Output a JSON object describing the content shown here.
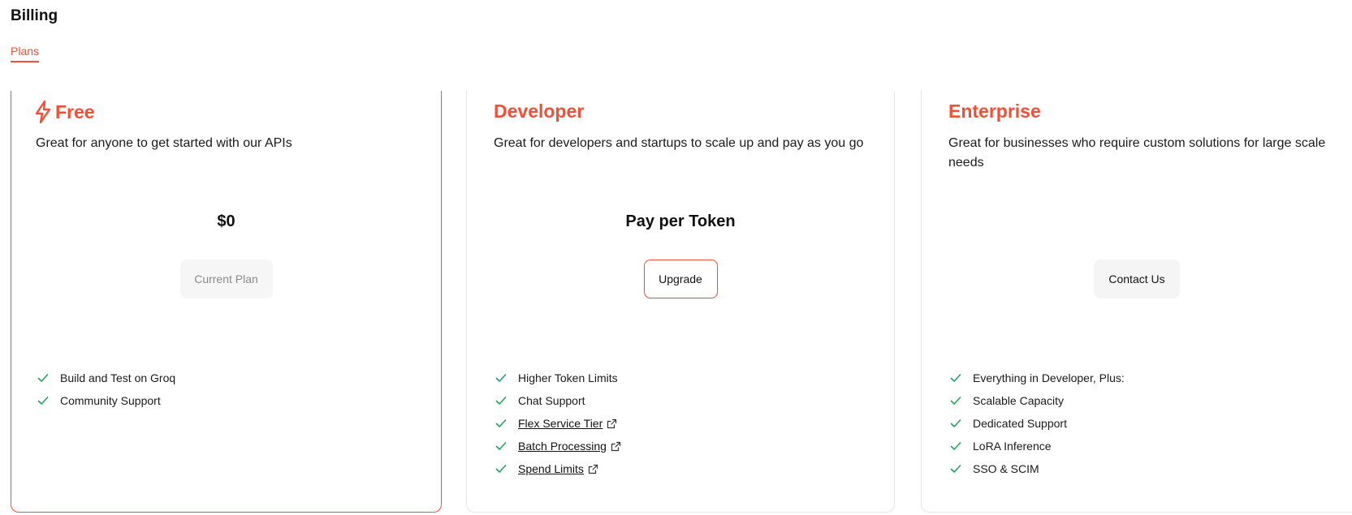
{
  "page": {
    "title": "Billing"
  },
  "tabs": [
    {
      "label": "Plans",
      "active": true
    }
  ],
  "colors": {
    "accent": "#f05033",
    "check": "#22a45d",
    "border": "#e4e4e4"
  },
  "plans": [
    {
      "name": "Free",
      "icon": "lightning-bolt-icon",
      "description": "Great for anyone to get started with our APIs",
      "price": "$0",
      "button": "Current Plan",
      "features": [
        {
          "label": "Build and Test on Groq",
          "link": false
        },
        {
          "label": "Community Support",
          "link": false
        }
      ]
    },
    {
      "name": "Developer",
      "description": "Great for developers and startups to scale up and pay as you go",
      "price": "Pay per Token",
      "button": "Upgrade",
      "features": [
        {
          "label": "Higher Token Limits",
          "link": false
        },
        {
          "label": "Chat Support",
          "link": false
        },
        {
          "label": "Flex Service Tier",
          "link": true
        },
        {
          "label": "Batch Processing",
          "link": true
        },
        {
          "label": "Spend Limits",
          "link": true
        }
      ]
    },
    {
      "name": "Enterprise",
      "description": "Great for businesses who require custom solutions for large scale needs",
      "price": "",
      "button": "Contact Us",
      "features": [
        {
          "label": "Everything in Developer, Plus:",
          "link": false
        },
        {
          "label": "Scalable Capacity",
          "link": false
        },
        {
          "label": "Dedicated Support",
          "link": false
        },
        {
          "label": "LoRA Inference",
          "link": false
        },
        {
          "label": "SSO & SCIM",
          "link": false
        }
      ]
    }
  ]
}
